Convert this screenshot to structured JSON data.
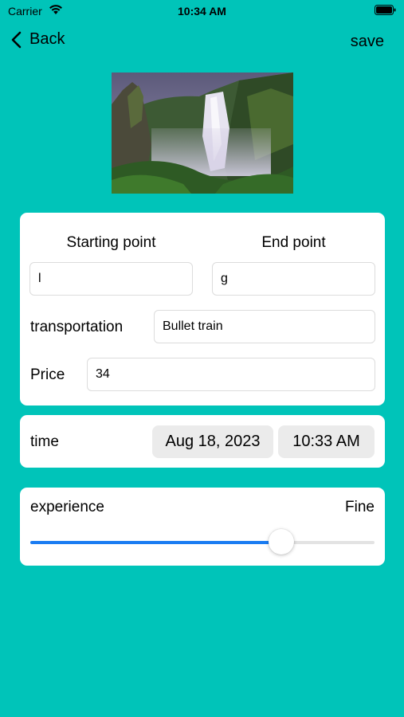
{
  "status_bar": {
    "carrier": "Carrier",
    "time": "10:34 AM",
    "icons": [
      "wifi-icon",
      "battery-icon"
    ]
  },
  "nav": {
    "back_label": "Back",
    "save_label": "save",
    "back_icon": "chevron-left-icon"
  },
  "route": {
    "start_label": "Starting point",
    "end_label": "End point",
    "start_value": "l",
    "end_value": "g",
    "transportation_label": "transportation",
    "transportation_value": "Bullet train",
    "price_label": "Price",
    "price_value": "34"
  },
  "time": {
    "label": "time",
    "date": "Aug 18, 2023",
    "clock": "10:33 AM"
  },
  "experience": {
    "label": "experience",
    "value_text": "Fine",
    "slider_fraction": 0.73
  },
  "colors": {
    "background": "#00c4b9",
    "accent": "#1a7cf2"
  }
}
